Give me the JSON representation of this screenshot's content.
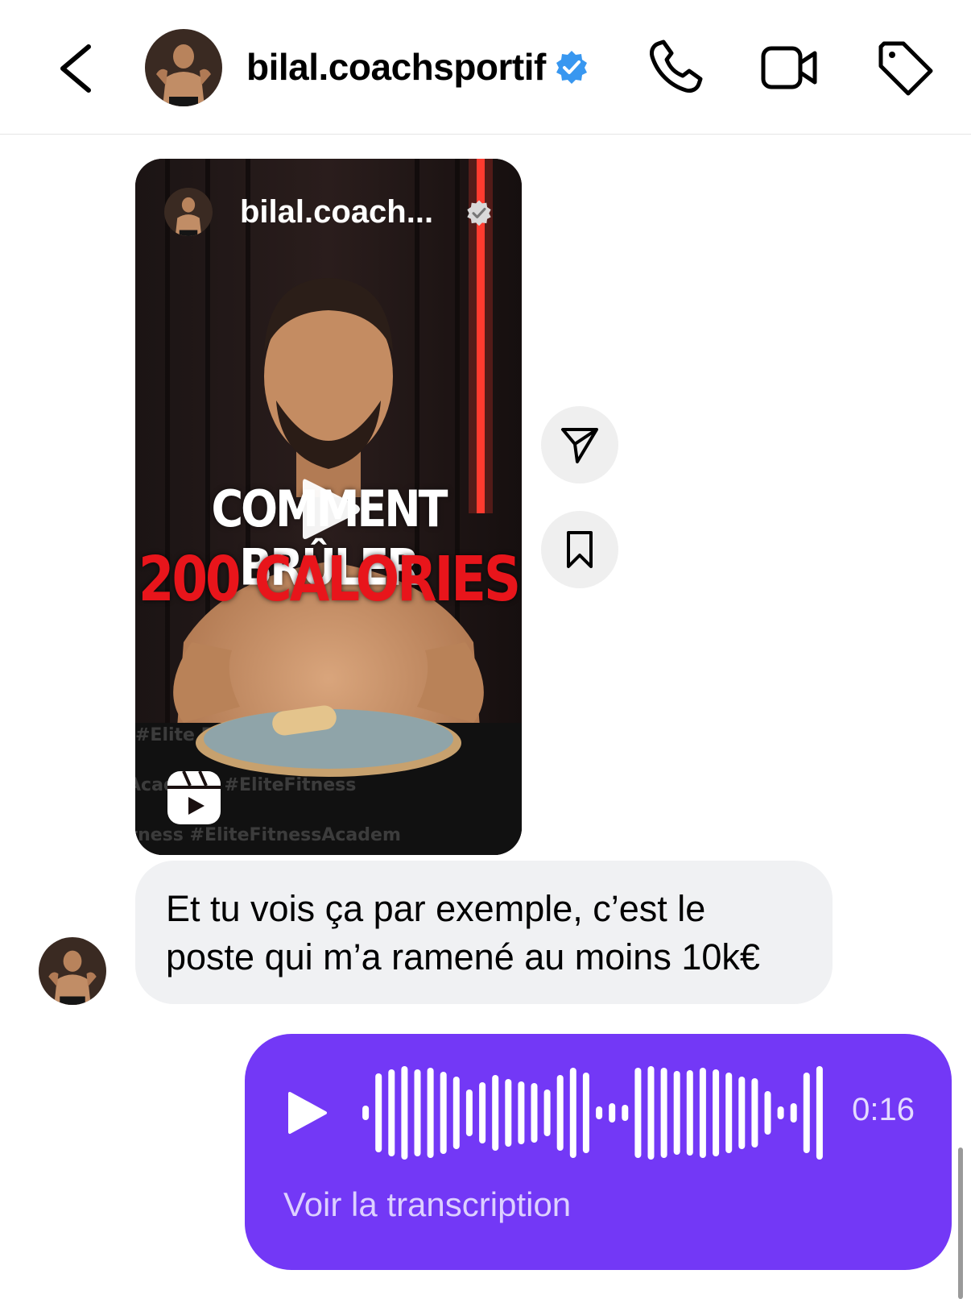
{
  "header": {
    "title": "bilal.coachsportif",
    "verified": true,
    "icons": [
      "back-chevron-icon",
      "phone-icon",
      "video-camera-icon",
      "tag-icon"
    ]
  },
  "reel": {
    "author": "bilal.coach...",
    "overlay_line1": "COMMENT BRÛLER",
    "overlay_line2": "200 CALORIES",
    "overlay_line2_color": "#e8151b"
  },
  "message": {
    "text": "Et tu vois ça par exemple, c’est le poste qui m’a ramené au moins 10k€"
  },
  "voice_message": {
    "duration": "0:16",
    "transcript_label": "Voir la transcription",
    "color": "#7338f6"
  },
  "colors": {
    "verified_blue": "#3897f0",
    "incoming_bubble": "#f0f1f3"
  }
}
